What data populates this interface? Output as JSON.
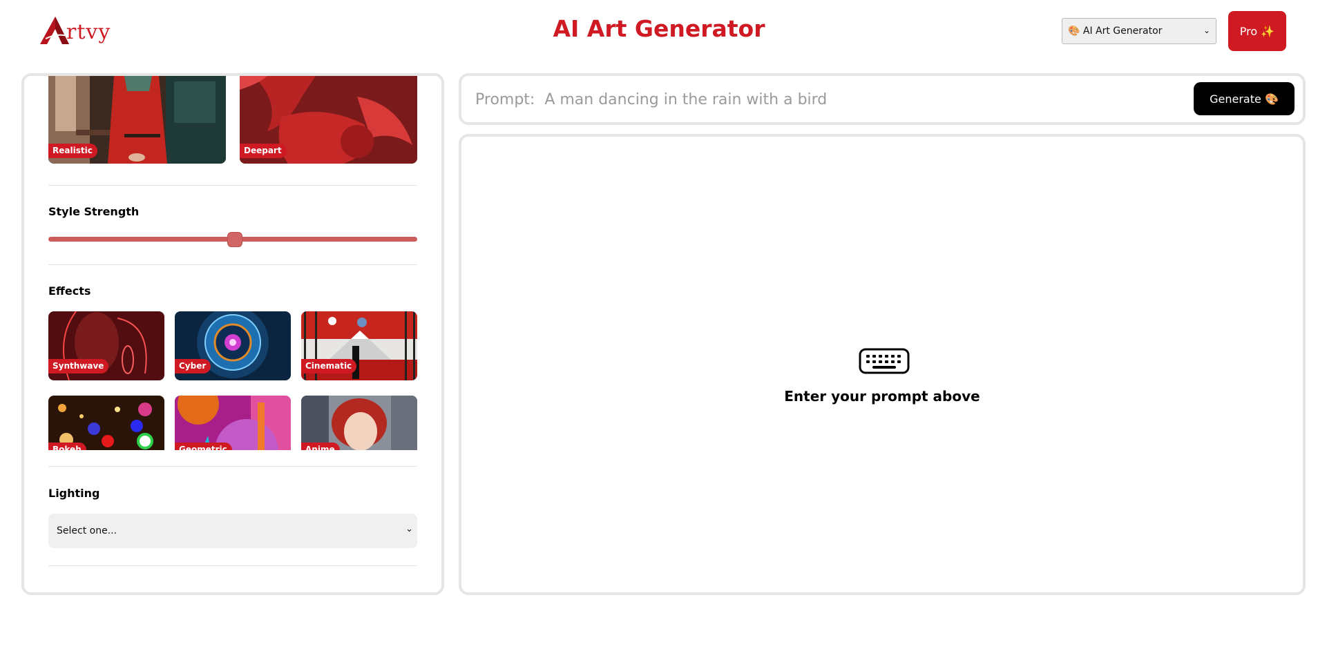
{
  "header": {
    "logo_text": "rtvy",
    "logo_initial": "A",
    "title": "AI Art Generator",
    "tool_select": {
      "value": "🎨 AI Art Generator"
    },
    "pro_button": "Pro ✨"
  },
  "styles": {
    "items": [
      {
        "label": "Realistic",
        "icon": "realistic-thumbnail"
      },
      {
        "label": "Deepart",
        "icon": "deepart-thumbnail"
      }
    ]
  },
  "style_strength": {
    "title": "Style Strength",
    "value": 0.5
  },
  "effects": {
    "title": "Effects",
    "items": [
      {
        "label": "Synthwave"
      },
      {
        "label": "Cyber"
      },
      {
        "label": "Cinematic"
      },
      {
        "label": "Bokeh"
      },
      {
        "label": "Geometric"
      },
      {
        "label": "Anime"
      }
    ]
  },
  "lighting": {
    "title": "Lighting",
    "value": "Select one..."
  },
  "prompt": {
    "placeholder": "Prompt:  A man dancing in the rain with a bird",
    "generate_label": "Generate 🎨"
  },
  "output": {
    "empty_text": "Enter your prompt above",
    "icon": "keyboard-icon"
  },
  "colors": {
    "brand": "#cf1a24",
    "slider": "#cc5c5c",
    "border": "#e5e5e5"
  }
}
